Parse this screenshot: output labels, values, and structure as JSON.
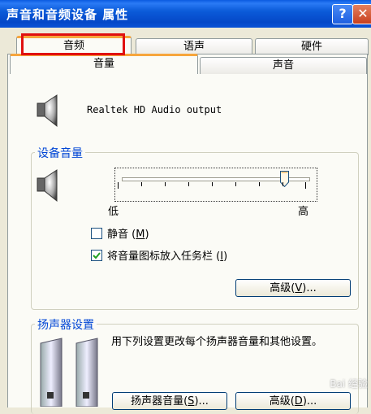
{
  "window": {
    "title": "声音和音频设备 属性",
    "help_label": "?",
    "close_label": "✕"
  },
  "tabs_row1": [
    "音频",
    "语声",
    "硬件"
  ],
  "tabs_row2": [
    "音量",
    "声音"
  ],
  "device": {
    "name": "Realtek HD Audio output",
    "icon": "speaker-icon"
  },
  "device_volume": {
    "group_label": "设备音量",
    "slider_low": "低",
    "slider_high": "高",
    "volume_level_fraction": 0.87,
    "mute_label": "静音",
    "mute_accel": "M",
    "mute_checked": false,
    "tray_label": "将音量图标放入任务栏",
    "tray_accel": "I",
    "tray_checked": true,
    "advanced_label": "高级",
    "advanced_accel": "V",
    "ellipsis": "..."
  },
  "speaker_settings": {
    "group_label": "扬声器设置",
    "description": "用下列设置更改每个扬声器音量和其他设置。",
    "speaker_volume_label": "扬声器音量",
    "speaker_volume_accel": "S",
    "advanced_label": "高级",
    "advanced_accel": "D",
    "ellipsis": "..."
  },
  "watermark": "Bai 经验"
}
